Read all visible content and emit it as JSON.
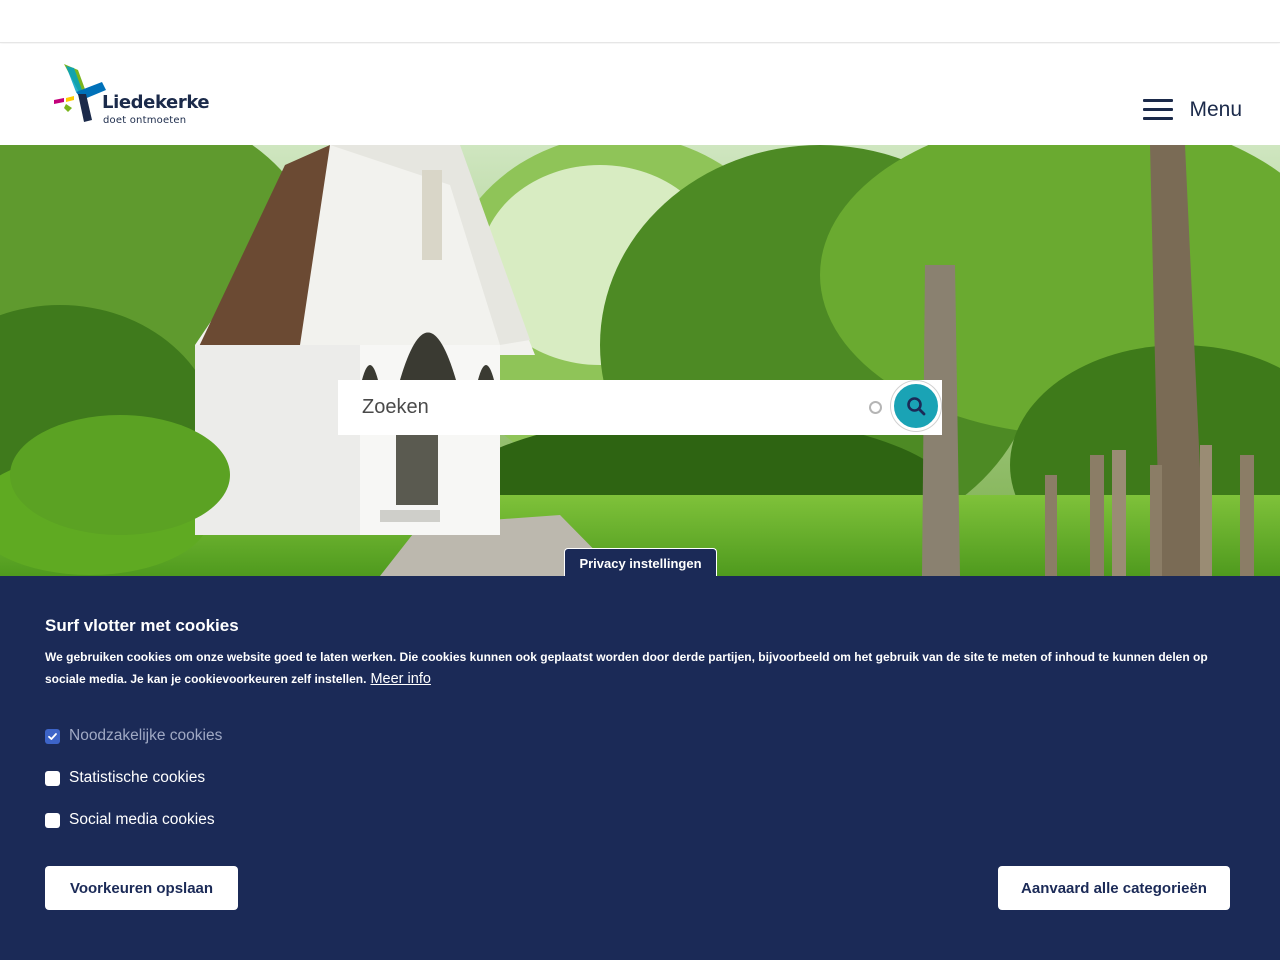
{
  "brand": {
    "name": "Liedekerke",
    "tagline": "doet ontmoeten",
    "colors": {
      "navy": "#1b2a57",
      "teal": "#1aa3b5",
      "logo_green": "#7ab51d",
      "logo_magenta": "#c3007a",
      "logo_blue": "#0071b9"
    }
  },
  "header": {
    "menu_label": "Menu",
    "menu_icon": "hamburger-icon"
  },
  "search": {
    "placeholder": "Zoeken",
    "button_icon": "search-icon"
  },
  "privacy_tab": {
    "label": "Privacy instellingen"
  },
  "cookie_banner": {
    "title": "Surf vlotter met cookies",
    "text": "We gebruiken cookies om onze website goed te laten werken. Die cookies kunnen ook geplaatst worden door derde partijen, bijvoorbeeld om het gebruik van de site te meten of inhoud te kunnen delen op sociale media. Je kan je cookievoorkeuren zelf instellen.",
    "more_info": "Meer info",
    "options": [
      {
        "label": "Noodzakelijke cookies",
        "checked": true,
        "disabled": true
      },
      {
        "label": "Statistische cookies",
        "checked": false,
        "disabled": false
      },
      {
        "label": "Social media cookies",
        "checked": false,
        "disabled": false
      }
    ],
    "save_button": "Voorkeuren opslaan",
    "accept_button": "Aanvaard alle categorieën"
  }
}
